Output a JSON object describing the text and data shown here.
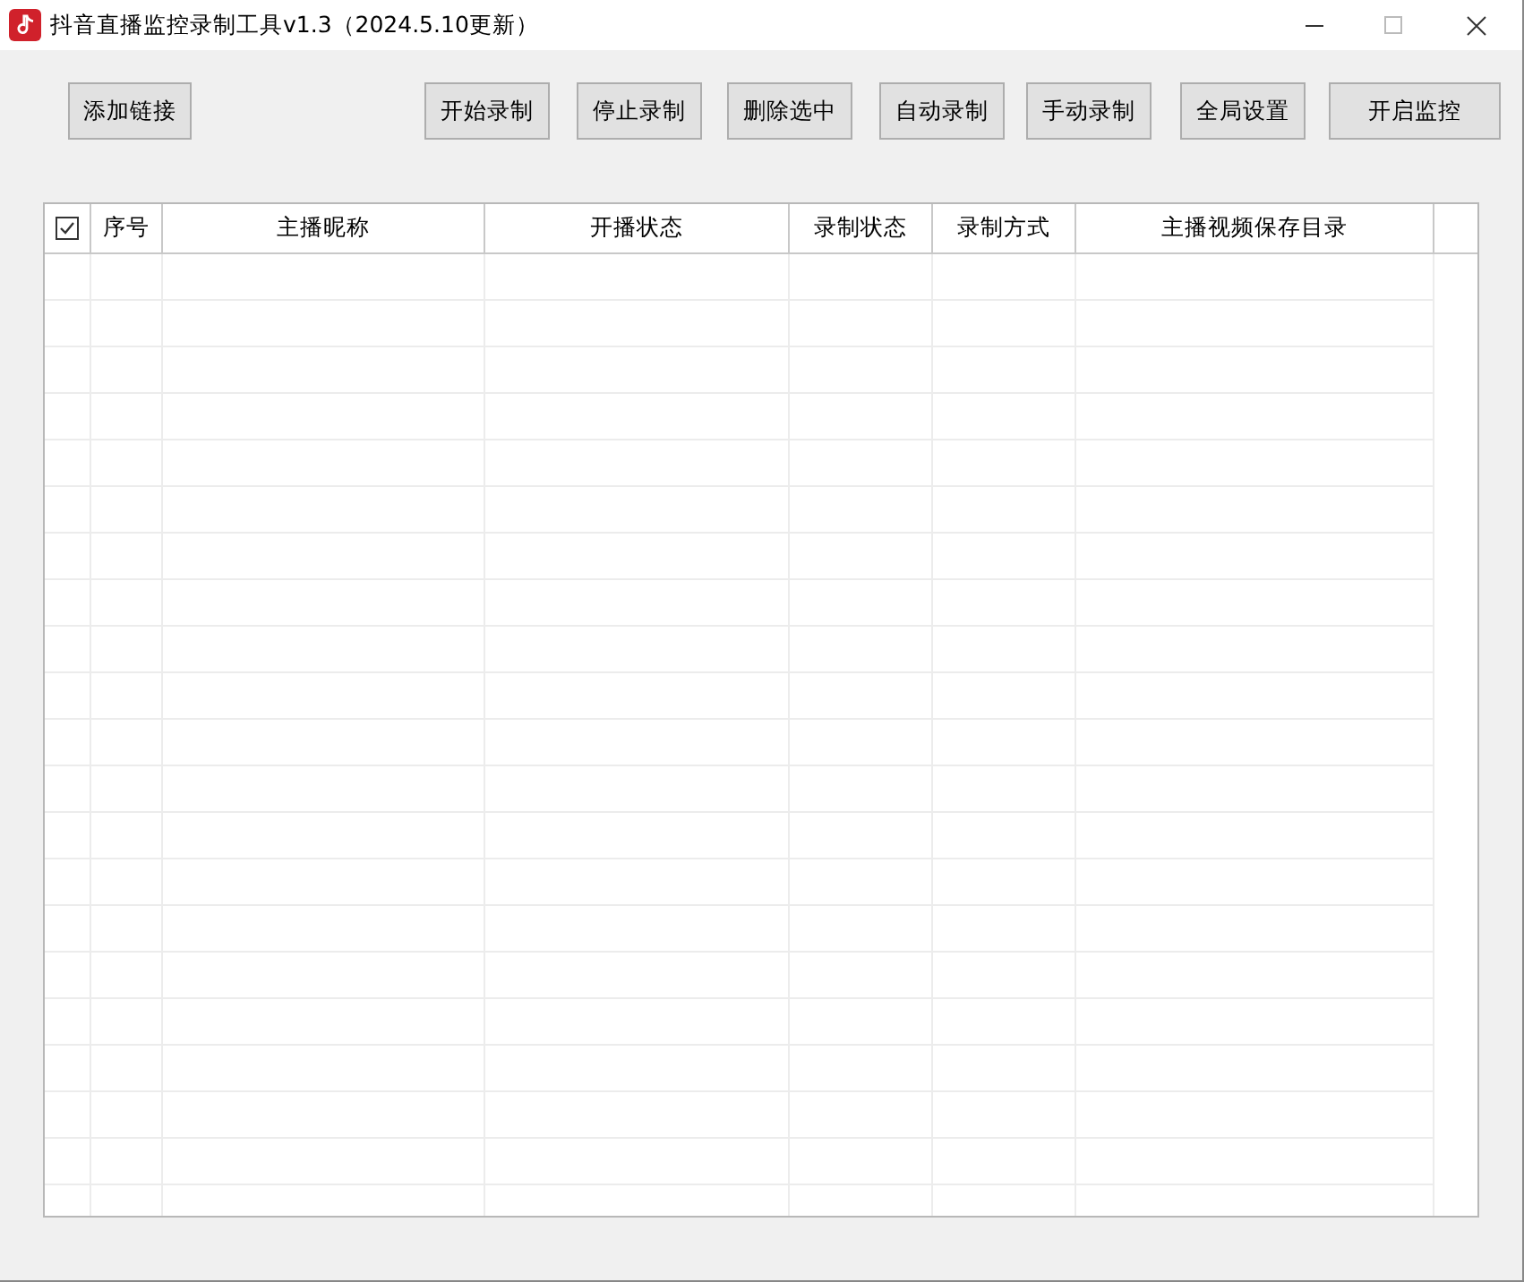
{
  "window": {
    "title": "抖音直播监控录制工具v1.3（2024.5.10更新）"
  },
  "toolbar": {
    "buttons": [
      "添加链接",
      "开始录制",
      "停止录制",
      "删除选中",
      "自动录制",
      "手动录制",
      "全局设置",
      "开启监控"
    ]
  },
  "table": {
    "select_all": {
      "checked": true
    },
    "columns": [
      "序号",
      "主播昵称",
      "开播状态",
      "录制状态",
      "录制方式",
      "主播视频保存目录"
    ]
  }
}
